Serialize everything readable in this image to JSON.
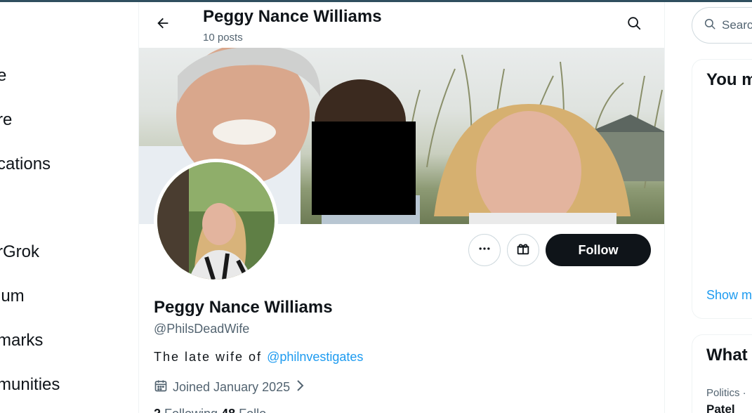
{
  "nav": {
    "items": [
      {
        "label": "e"
      },
      {
        "label": "re"
      },
      {
        "label": "cations"
      },
      {
        "label": "rGrok"
      },
      {
        "label": "ium"
      },
      {
        "label": "marks"
      },
      {
        "label": "munities"
      }
    ]
  },
  "header": {
    "title": "Peggy Nance Williams",
    "subtitle": "10 posts",
    "back_icon": "arrow-left-icon",
    "search_icon": "search-icon"
  },
  "profile": {
    "name": "Peggy Nance Williams",
    "handle": "@PhilsDeadWife",
    "bio_text": "The late wife of ",
    "bio_link": "@philnvestigates",
    "joined": "Joined January 2025",
    "following_count": "2",
    "following_label": " Following  ",
    "followers_count": "48",
    "followers_label": " Follo",
    "follow_label": "Follow",
    "more_icon": "more-horizontal-icon",
    "gift_icon": "gift-icon"
  },
  "right": {
    "search_placeholder": "Searc",
    "card1_title": "You m",
    "card1_show_more": "Show m",
    "card2_title": "What",
    "trend_meta": "Politics ·",
    "trend_name": "Patel"
  },
  "colors": {
    "accent": "#1d9bf0",
    "text": "#0f1419",
    "muted": "#536471",
    "follow_bg": "#0f1419"
  }
}
